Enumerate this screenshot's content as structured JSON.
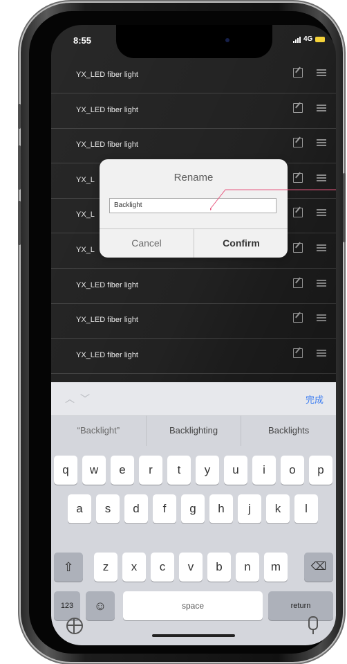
{
  "status_bar": {
    "time": "8:55",
    "network": "4G"
  },
  "device_list": {
    "items": [
      {
        "label": "YX_LED fiber light"
      },
      {
        "label": "YX_LED fiber light"
      },
      {
        "label": "YX_LED fiber light"
      },
      {
        "label": "YX_L"
      },
      {
        "label": "YX_L"
      },
      {
        "label": "YX_L"
      },
      {
        "label": "YX_LED fiber light"
      },
      {
        "label": "YX_LED fiber light"
      },
      {
        "label": "YX_LED fiber light"
      }
    ]
  },
  "rename_dialog": {
    "title": "Rename",
    "input_value": "Backlight",
    "cancel_label": "Cancel",
    "confirm_label": "Confirm"
  },
  "keyboard": {
    "done_label": "完成",
    "suggestions": [
      "“Backlight”",
      "Backlighting",
      "Backlights"
    ],
    "row1": [
      "q",
      "w",
      "e",
      "r",
      "t",
      "y",
      "u",
      "i",
      "o",
      "p"
    ],
    "row2": [
      "a",
      "s",
      "d",
      "f",
      "g",
      "h",
      "j",
      "k",
      "l"
    ],
    "row3": [
      "z",
      "x",
      "c",
      "v",
      "b",
      "n",
      "m"
    ],
    "numbers_label": "123",
    "emoji_label": "☺",
    "space_label": "space",
    "return_label": "return",
    "shift_label": "⇧",
    "delete_label": "⌫"
  },
  "colors": {
    "accent_done": "#3d7df1",
    "annotation": "#e8577f",
    "battery": "#f4d23a"
  }
}
